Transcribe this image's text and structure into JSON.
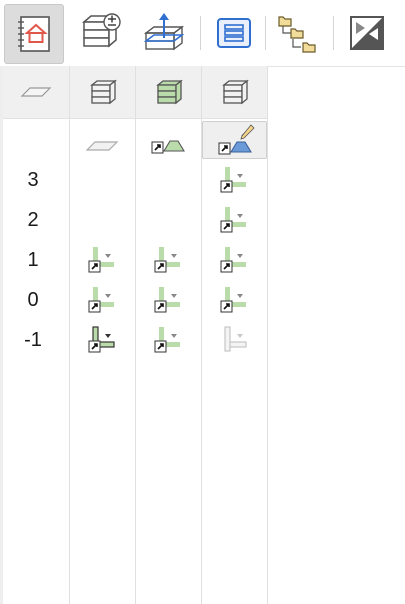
{
  "toolbar": {
    "buttons": [
      {
        "name": "project-home",
        "icon": "notebook-house-icon",
        "active": true
      },
      {
        "name": "model-add-remove",
        "icon": "stack-plus-minus-icon"
      },
      {
        "name": "level-elevation",
        "icon": "box-arrow-up-icon"
      },
      {
        "name": "list-view",
        "icon": "list-icon"
      },
      {
        "name": "hierarchy",
        "icon": "folder-tree-icon"
      },
      {
        "name": "split-view",
        "icon": "diagonal-split-icon"
      }
    ]
  },
  "columns": [
    {
      "icon": "slab-icon"
    },
    {
      "icon": "stack-gray-icon"
    },
    {
      "icon": "stack-green-icon"
    },
    {
      "icon": "stack-gray-icon"
    }
  ],
  "rows": [
    {
      "label": "3"
    },
    {
      "label": "2"
    },
    {
      "label": "1"
    },
    {
      "label": "0"
    },
    {
      "label": "-1"
    }
  ],
  "colors": {
    "green": "#b9dcaa",
    "blue": "#6a9bd8",
    "folder": "#f2dc9a",
    "active_bg": "#dcdcdc"
  }
}
